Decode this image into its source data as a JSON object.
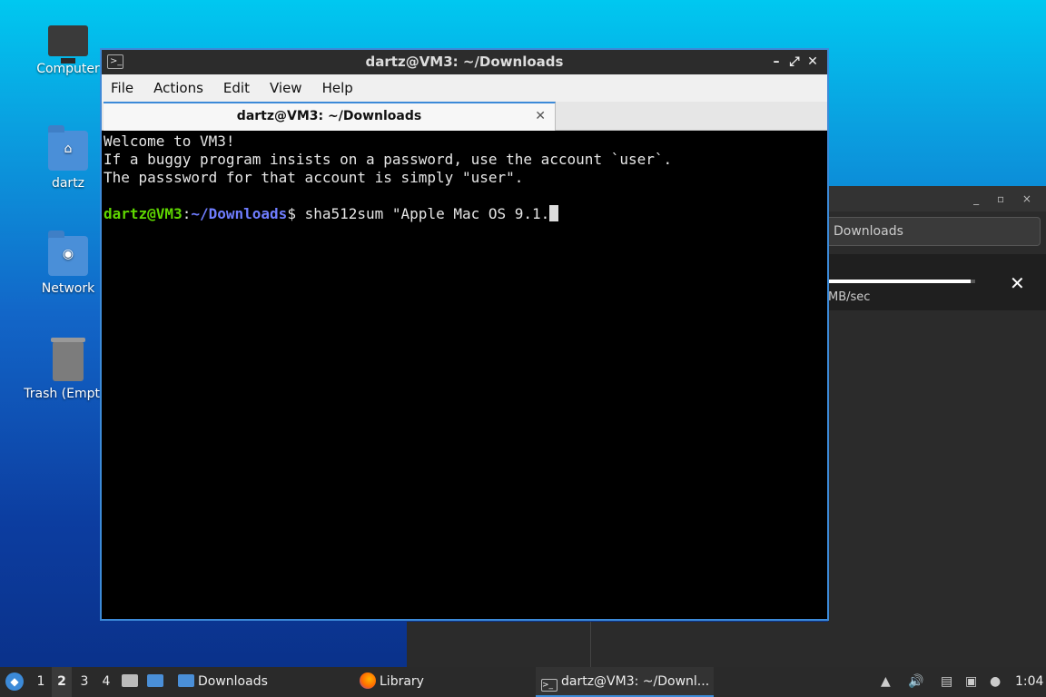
{
  "desktop": {
    "icons": [
      {
        "label": "Computer"
      },
      {
        "label": "dartz"
      },
      {
        "label": "Network"
      },
      {
        "label": "Trash (Empty)"
      }
    ]
  },
  "background_window": {
    "address": "Downloads",
    "download_progress": 0.97,
    "transfer_rate": "MB/sec"
  },
  "terminal_window": {
    "title": "dartz@VM3: ~/Downloads",
    "menu": [
      "File",
      "Actions",
      "Edit",
      "View",
      "Help"
    ],
    "tab_label": "dartz@VM3: ~/Downloads",
    "lines": [
      "Welcome to VM3!",
      "If a buggy program insists on a password, use the account `user`.",
      "The passsword for that account is simply \"user\"."
    ],
    "prompt_user": "dartz@VM3",
    "prompt_sep": ":",
    "prompt_path": "~/Downloads",
    "prompt_symbol": "$ ",
    "command": "sha512sum \"Apple Mac OS 9.1."
  },
  "taskbar": {
    "workspaces": [
      "1",
      "2",
      "3",
      "4"
    ],
    "active_workspace": "2",
    "tasks": [
      {
        "label": "Downloads"
      },
      {
        "label": "Library"
      },
      {
        "label": "dartz@VM3: ~/Downl..."
      }
    ],
    "clock": "1:04"
  }
}
